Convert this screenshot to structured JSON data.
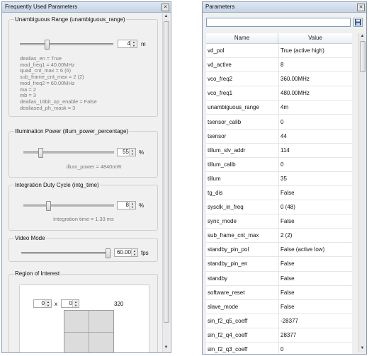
{
  "left_window": {
    "title": "Frequently Used Parameters",
    "unambiguous_range": {
      "title": "Unambiguous Range (unambiguous_range)",
      "value": "4",
      "unit": "m",
      "slider_fraction": 0.28,
      "info_lines": [
        "dealias_en = True",
        "mod_freq1 = 40.00MHz",
        "quad_cnt_max = 6 (6)",
        "sub_frame_cnt_max = 2 (2)",
        "mod_freq2 = 60.00MHz",
        "ma = 2",
        "mb = 3",
        "dealias_16bit_op_enable = False",
        "dealiased_ph_mask = 3"
      ]
    },
    "illumination_power": {
      "title": "Illumination Power (illum_power_percentage)",
      "value": "55",
      "unit": "%",
      "slider_fraction": 0.17,
      "info": "illum_power = 4840mW"
    },
    "integration_duty_cycle": {
      "title": "Integration Duty Cycle (intg_time)",
      "value": "8",
      "unit": "%",
      "slider_fraction": 0.26,
      "info": "Integration time = 1.33 ms"
    },
    "video_mode": {
      "title": "Video Mode",
      "value": "60.00",
      "unit": "fps",
      "slider_fraction": 1.0
    },
    "region_of_interest": {
      "title": "Region of Interest",
      "x_value": "0",
      "y_value": "0",
      "x_label": "x",
      "width_label": "320"
    }
  },
  "right_window": {
    "title": "Parameters",
    "search_placeholder": "",
    "columns": [
      "Name",
      "Value"
    ],
    "rows": [
      {
        "name": "vd_pol",
        "value": "True (active high)"
      },
      {
        "name": "vd_active",
        "value": "8"
      },
      {
        "name": "vco_freq2",
        "value": "360.00MHz"
      },
      {
        "name": "vco_freq1",
        "value": "480.00MHz"
      },
      {
        "name": "unambiguous_range",
        "value": "4m"
      },
      {
        "name": "tsensor_calib",
        "value": "0"
      },
      {
        "name": "tsensor",
        "value": "44"
      },
      {
        "name": "tillum_slv_addr",
        "value": "114"
      },
      {
        "name": "tillum_calib",
        "value": "0"
      },
      {
        "name": "tillum",
        "value": "35"
      },
      {
        "name": "tg_dis",
        "value": "False"
      },
      {
        "name": "sysclk_in_freq",
        "value": "0 (48)"
      },
      {
        "name": "sync_mode",
        "value": "False"
      },
      {
        "name": "sub_frame_cnt_max",
        "value": "2 (2)"
      },
      {
        "name": "standby_pin_pol",
        "value": "False (active low)"
      },
      {
        "name": "standby_pin_en",
        "value": "False"
      },
      {
        "name": "standby",
        "value": "False"
      },
      {
        "name": "software_reset",
        "value": "False"
      },
      {
        "name": "slave_mode",
        "value": "False"
      },
      {
        "name": "sin_f2_q5_coeff",
        "value": "-28377"
      },
      {
        "name": "sin_f2_q4_coeff",
        "value": "28377"
      },
      {
        "name": "sin_f2_q3_coeff",
        "value": "0"
      }
    ]
  },
  "icons": {
    "close": "close-icon",
    "save": "save-icon"
  }
}
